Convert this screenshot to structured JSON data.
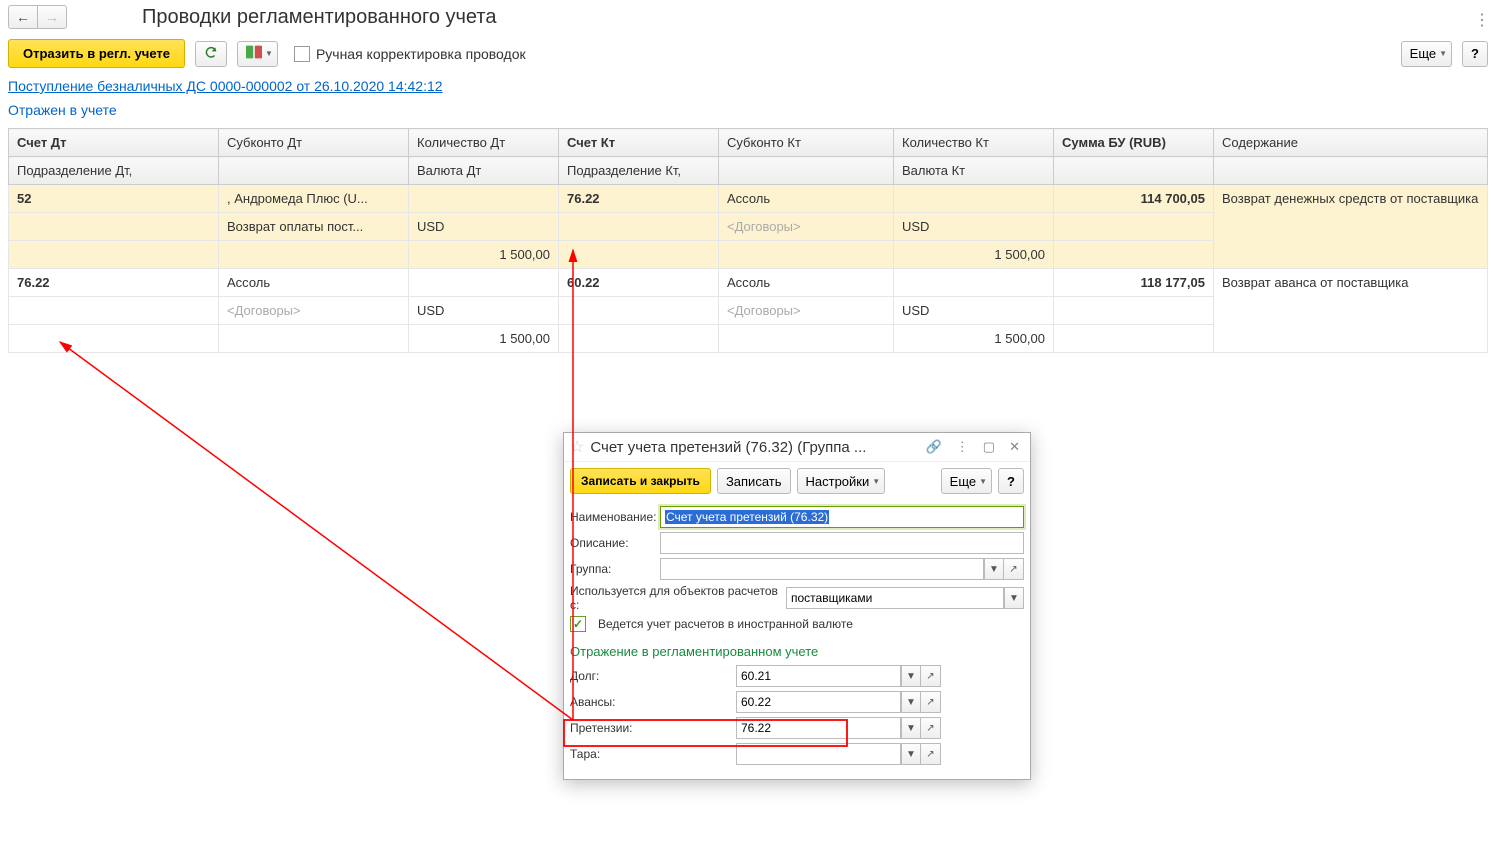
{
  "header": {
    "title": "Проводки регламентированного учета"
  },
  "toolbar": {
    "reflect": "Отразить в регл. учете",
    "manualCorrection": "Ручная корректировка проводок",
    "more": "Еще",
    "help": "?"
  },
  "docLink": "Поступление безналичных ДС 0000-000002 от 26.10.2020 14:42:12",
  "status": "Отражен в учете",
  "table": {
    "h1": {
      "accDt": "Счет Дт",
      "subDt": "Субконто Дт",
      "qtyDt": "Количество Дт",
      "accKt": "Счет Кт",
      "subKt": "Субконто Кт",
      "qtyKt": "Количество Кт",
      "sum": "Сумма БУ (RUB)",
      "desc": "Содержание"
    },
    "h2": {
      "divDt": "Подразделение Дт,",
      "curDt": "Валюта Дт",
      "divKt": "Подразделение Кт,",
      "curKt": "Валюта Кт"
    },
    "rows": [
      {
        "accDt": "52",
        "subDt1": ", Андромеда Плюс (U...",
        "subDt2": "Возврат оплаты пост...",
        "curDt": "USD",
        "qtyDt": "1 500,00",
        "accKt": "76.22",
        "subKt1": "Ассоль",
        "subKt2": "<Договоры>",
        "curKt": "USD",
        "qtyKt": "1 500,00",
        "sum": "114 700,05",
        "desc": "Возврат денежных средств от поставщика"
      },
      {
        "accDt": "76.22",
        "subDt1": "Ассоль",
        "subDt2": "<Договоры>",
        "curDt": "USD",
        "qtyDt": "1 500,00",
        "accKt": "60.22",
        "subKt1": "Ассоль",
        "subKt2": "<Договоры>",
        "curKt": "USD",
        "qtyKt": "1 500,00",
        "sum": "118 177,05",
        "desc": "Возврат аванса от поставщика"
      }
    ]
  },
  "popup": {
    "title": "Счет учета претензий (76.32) (Группа ...",
    "btns": {
      "saveClose": "Записать и закрыть",
      "save": "Записать",
      "settings": "Настройки",
      "more": "Еще",
      "help": "?"
    },
    "labels": {
      "name": "Наименование:",
      "desc": "Описание:",
      "group": "Группа:",
      "usedFor": "Используется для объектов расчетов с:",
      "foreignCurrency": "Ведется учет расчетов в иностранной валюте",
      "section": "Отражение в регламентированном учете",
      "debt": "Долг:",
      "advance": "Авансы:",
      "claims": "Претензии:",
      "tara": "Тара:"
    },
    "values": {
      "name": "Счет учета претензий (76.32)",
      "usedFor": "поставщиками",
      "debt": "60.21",
      "advance": "60.22",
      "claims": "76.22",
      "tara": ""
    }
  }
}
